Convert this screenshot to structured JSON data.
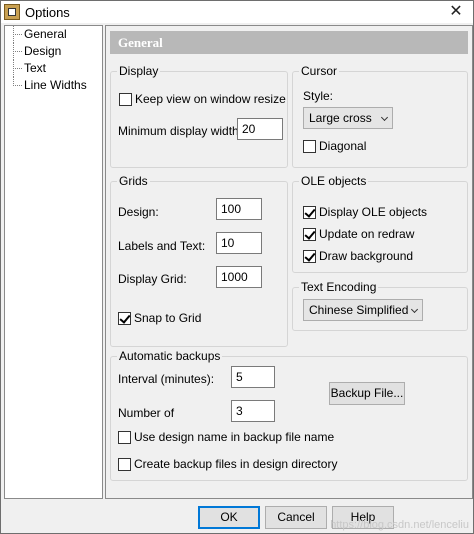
{
  "window": {
    "title": "Options"
  },
  "tree": {
    "items": [
      "General",
      "Design",
      "Text",
      "Line Widths"
    ]
  },
  "panel": {
    "header": "General"
  },
  "display": {
    "title": "Display",
    "keep_view_label": "Keep view on window resize",
    "keep_view_checked": false,
    "min_width_label": "Minimum display width:",
    "min_width_value": "20"
  },
  "cursor": {
    "title": "Cursor",
    "style_label": "Style:",
    "style_value": "Large cross",
    "diagonal_label": "Diagonal",
    "diagonal_checked": false
  },
  "grids": {
    "title": "Grids",
    "design_label": "Design:",
    "design_value": "100",
    "labels_text_label": "Labels and Text:",
    "labels_text_value": "10",
    "display_grid_label": "Display Grid:",
    "display_grid_value": "1000",
    "snap_label": "Snap to Grid",
    "snap_checked": true
  },
  "ole": {
    "title": "OLE objects",
    "display_label": "Display OLE objects",
    "display_checked": true,
    "update_label": "Update on redraw",
    "update_checked": true,
    "draw_bg_label": "Draw background",
    "draw_bg_checked": true
  },
  "encoding": {
    "title": "Text Encoding",
    "value": "Chinese Simplified"
  },
  "backups": {
    "title": "Automatic backups",
    "interval_label": "Interval (minutes):",
    "interval_value": "5",
    "number_label": "Number of",
    "number_value": "3",
    "backup_file_button": "Backup File...",
    "use_design_name_label": "Use design name in backup file name",
    "use_design_name_checked": false,
    "create_in_dir_label": "Create backup files in design directory",
    "create_in_dir_checked": false
  },
  "footer": {
    "ok": "OK",
    "cancel": "Cancel",
    "help": "Help",
    "watermark": "https://blog.csdn.net/lenceliu"
  }
}
